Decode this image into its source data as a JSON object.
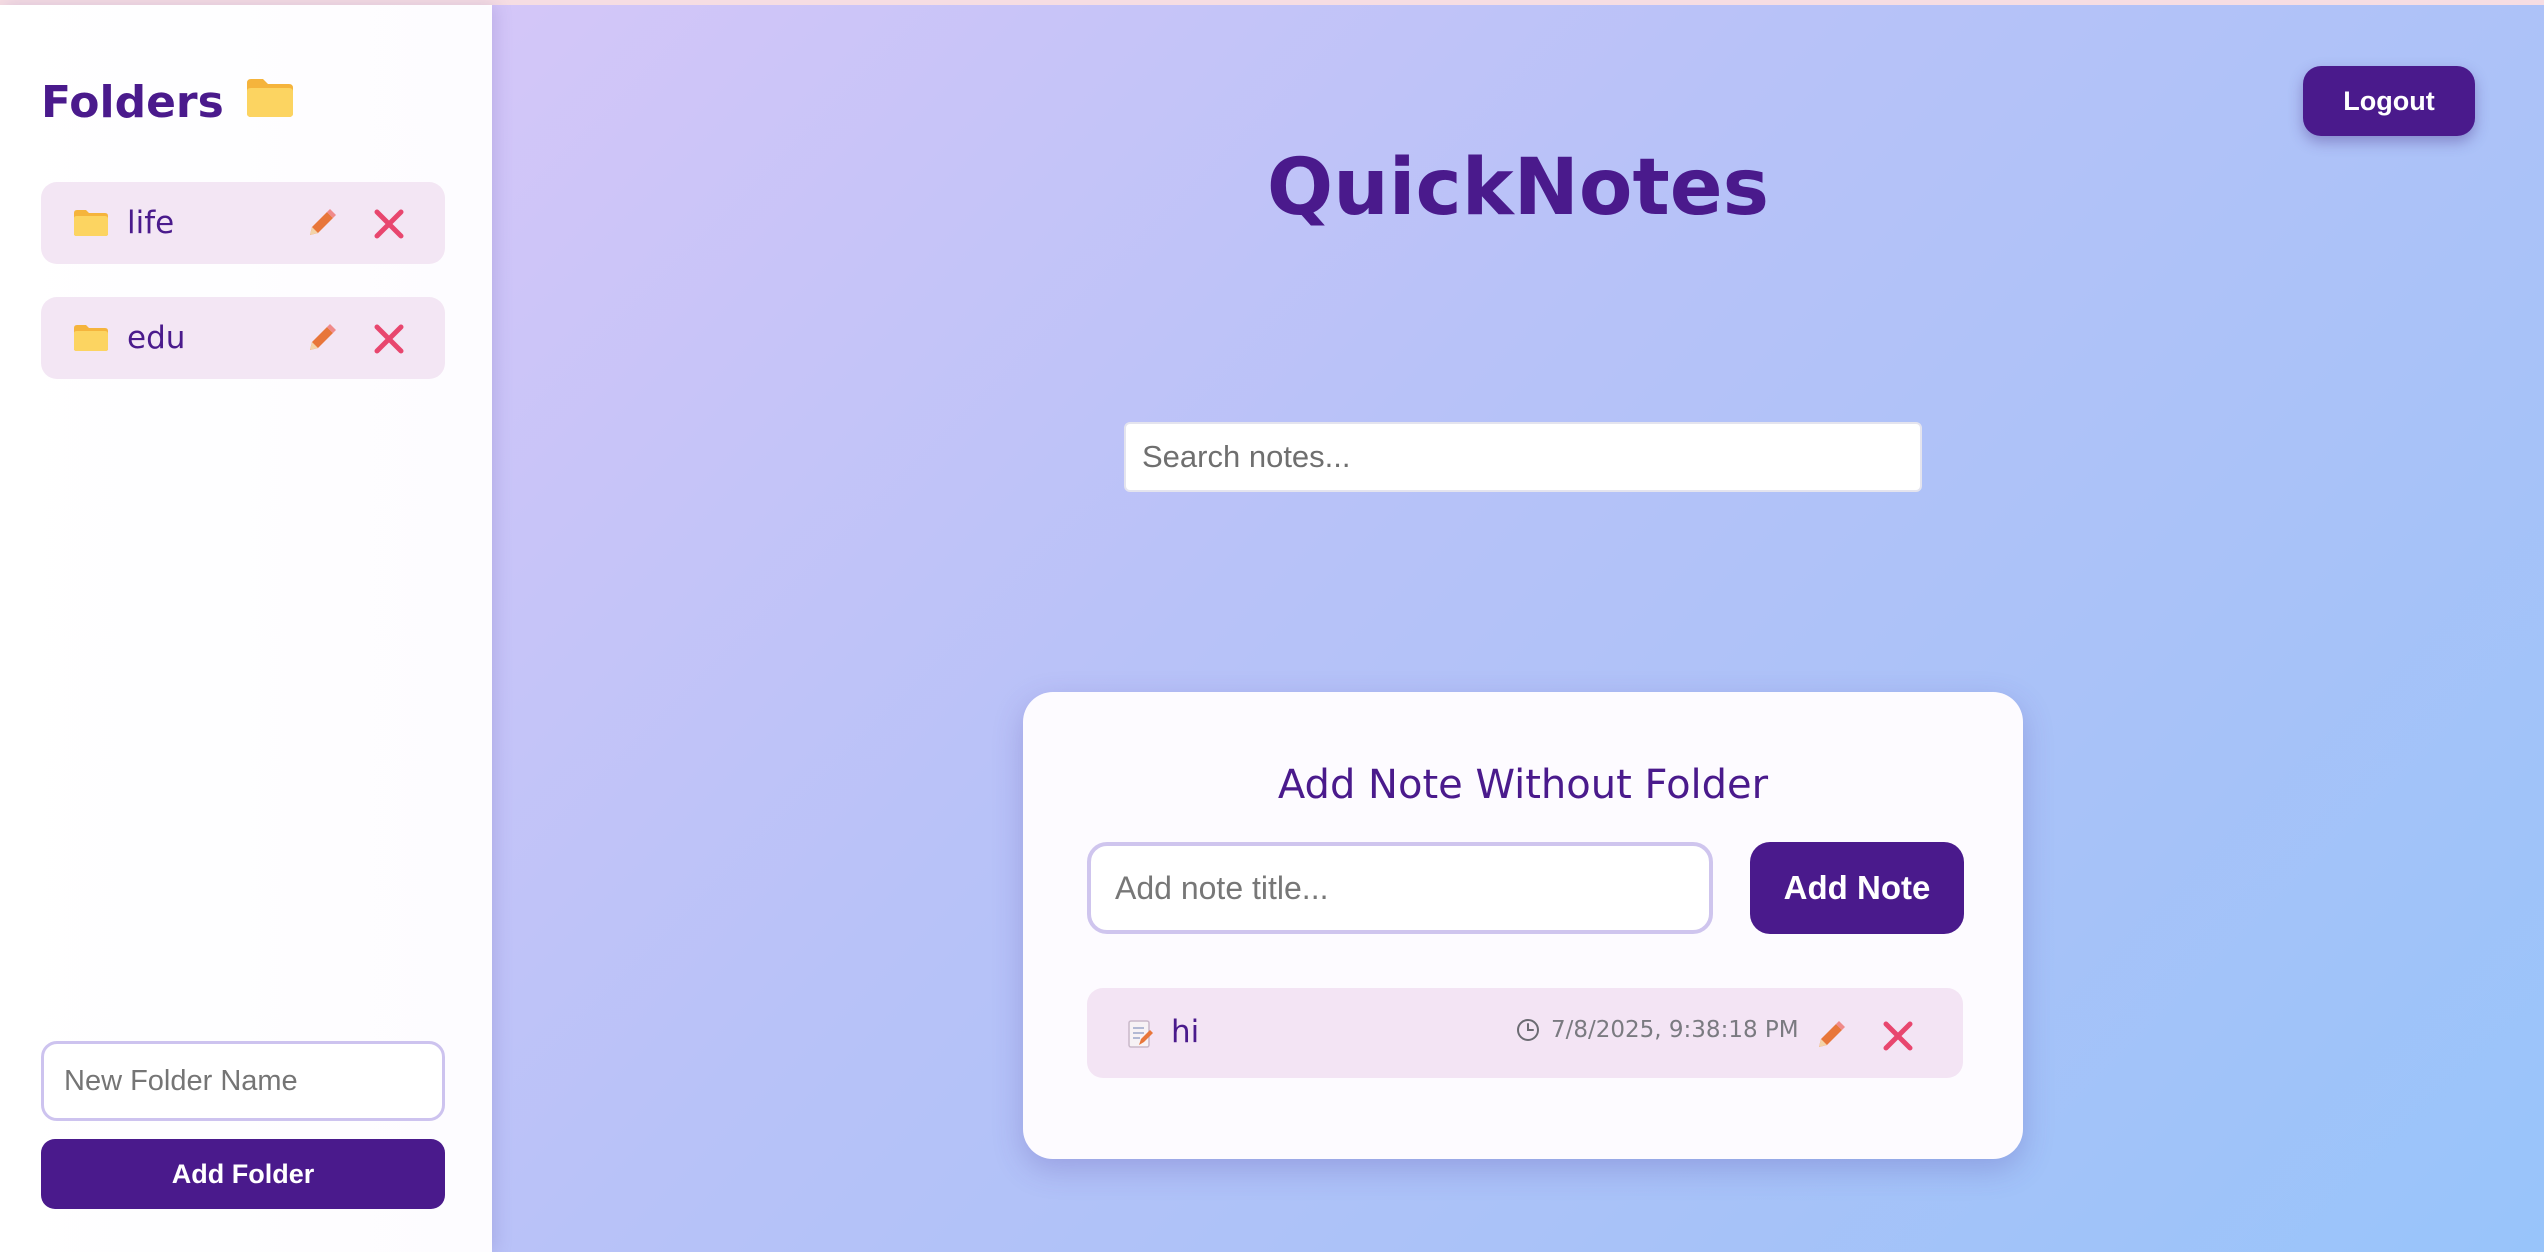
{
  "sidebar": {
    "title": "Folders",
    "title_icon": "folder-icon",
    "folders": [
      {
        "label": "life",
        "icon": "folder-icon"
      },
      {
        "label": "edu",
        "icon": "folder-icon"
      }
    ],
    "new_folder_placeholder": "New Folder Name",
    "add_folder_label": "Add Folder"
  },
  "header": {
    "logout_label": "Logout",
    "app_title": "QuickNotes"
  },
  "search": {
    "placeholder": "Search notes..."
  },
  "card": {
    "title": "Add Note Without Folder",
    "note_input_placeholder": "Add note title...",
    "add_note_label": "Add Note",
    "notes": [
      {
        "title": "hi",
        "timestamp": "7/8/2025, 9:38:18 PM",
        "icon": "memo-icon"
      }
    ]
  },
  "colors": {
    "accent": "#4a1a8c",
    "item_bg": "#f3e6f4",
    "edit_icon": "#e8763a",
    "delete_icon": "#e8466e"
  }
}
